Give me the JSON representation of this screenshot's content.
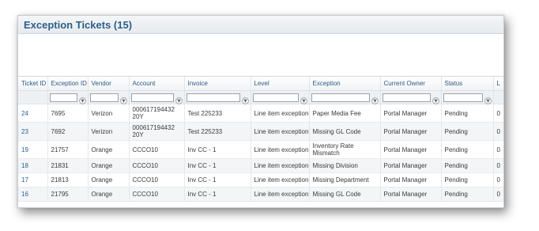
{
  "panel": {
    "title": "Exception Tickets (15)"
  },
  "columns": [
    {
      "key": "ticket_id",
      "label": "Ticket ID",
      "filter": false
    },
    {
      "key": "exception_id",
      "label": "Exception ID",
      "filter": true
    },
    {
      "key": "vendor",
      "label": "Vendor",
      "filter": true
    },
    {
      "key": "account",
      "label": "Account",
      "filter": true
    },
    {
      "key": "invoice",
      "label": "Invoice",
      "filter": true
    },
    {
      "key": "level",
      "label": "Level",
      "filter": true
    },
    {
      "key": "exception",
      "label": "Exception",
      "filter": true
    },
    {
      "key": "current_owner",
      "label": "Current Owner",
      "filter": true
    },
    {
      "key": "status",
      "label": "Status",
      "filter": true
    },
    {
      "key": "extra",
      "label": "L",
      "filter": false
    }
  ],
  "rows": [
    {
      "ticket_id": "24",
      "exception_id": "7695",
      "vendor": "Verizon",
      "account": "000617194432 20Y",
      "invoice": "Test 225233",
      "level": "Line item exception",
      "exception": "Paper Media Fee",
      "current_owner": "Portal Manager",
      "status": "Pending",
      "extra": "0"
    },
    {
      "ticket_id": "23",
      "exception_id": "7692",
      "vendor": "Verizon",
      "account": "000617194432 20Y",
      "invoice": "Test 225233",
      "level": "Line item exception",
      "exception": "Missing GL Code",
      "current_owner": "Portal Manager",
      "status": "Pending",
      "extra": "0"
    },
    {
      "ticket_id": "19",
      "exception_id": "21757",
      "vendor": "Orange",
      "account": "CCCO10",
      "invoice": "Inv CC - 1",
      "level": "Line item exception",
      "exception": "Inventory Rate Mismatch",
      "current_owner": "Portal Manager",
      "status": "Pending",
      "extra": "0"
    },
    {
      "ticket_id": "18",
      "exception_id": "21831",
      "vendor": "Orange",
      "account": "CCCO10",
      "invoice": "Inv CC - 1",
      "level": "Line item exception",
      "exception": "Missing Division",
      "current_owner": "Portal Manager",
      "status": "Pending",
      "extra": "0"
    },
    {
      "ticket_id": "17",
      "exception_id": "21813",
      "vendor": "Orange",
      "account": "CCCO10",
      "invoice": "Inv CC - 1",
      "level": "Line item exception",
      "exception": "Missing Department",
      "current_owner": "Portal Manager",
      "status": "Pending",
      "extra": "0"
    },
    {
      "ticket_id": "16",
      "exception_id": "21795",
      "vendor": "Orange",
      "account": "CCCO10",
      "invoice": "Inv CC - 1",
      "level": "Line item exception",
      "exception": "Missing GL Code",
      "current_owner": "Portal Manager",
      "status": "Pending",
      "extra": "0"
    }
  ],
  "icons": {
    "filter": "filter-icon"
  },
  "colors": {
    "title": "#2d5f8a",
    "header_text": "#2c5a85",
    "link": "#2a5d8f"
  }
}
